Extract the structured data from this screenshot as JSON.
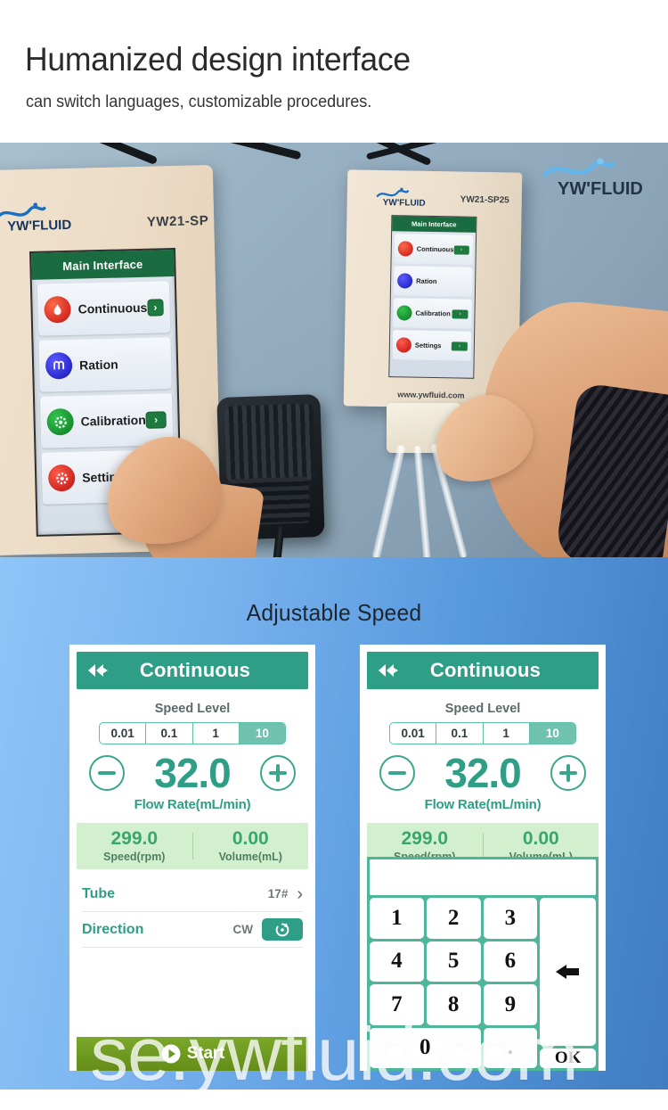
{
  "header": {
    "title": "Humanized design interface",
    "subtitle": "can switch languages, customizable procedures."
  },
  "photo": {
    "brand_logo": "YW'FLUID",
    "left_device": {
      "brand": "YW'FLUID",
      "model": "YW21-SP",
      "screen_title": "Main Interface",
      "menu": [
        {
          "label": "Continuous",
          "icon": "flame-drop-icon",
          "icon_color": "#d41f1f",
          "arrow": "›"
        },
        {
          "label": "Ration",
          "icon": "ration-icon",
          "icon_color": "#2020c8",
          "arrow": "›"
        },
        {
          "label": "Calibration",
          "icon": "gear-icon",
          "icon_color": "#108a28",
          "arrow": "›"
        },
        {
          "label": "Settings",
          "icon": "settings-gear-icon",
          "icon_color": "#d42020",
          "arrow": "›"
        }
      ]
    },
    "right_device": {
      "brand": "YW'FLUID",
      "model": "YW21-SP25",
      "url": "www.ywfluid.com",
      "screen_title": "Main Interface",
      "menu": [
        {
          "label": "Continuous",
          "icon_color": "#d41f1f",
          "arrow": "›"
        },
        {
          "label": "Ration",
          "icon_color": "#2020c8",
          "arrow": "›"
        },
        {
          "label": "Calibration",
          "icon_color": "#108a28",
          "arrow": "›"
        },
        {
          "label": "Settings",
          "icon_color": "#d42020",
          "arrow": "›"
        }
      ]
    }
  },
  "blue_section": {
    "title": "Adjustable Speed",
    "panel_left": {
      "header_title": "Continuous",
      "back_icon": "double-back-arrow-icon",
      "speed_level_label": "Speed Level",
      "speed_levels": [
        "0.01",
        "0.1",
        "1",
        "10"
      ],
      "speed_level_selected": "10",
      "minus_label": "−",
      "plus_label": "+",
      "flow_value": "32.0",
      "flow_unit": "Flow Rate(mL/min)",
      "stats": [
        {
          "value": "299.0",
          "label": "Speed(rpm)"
        },
        {
          "value": "0.00",
          "label": "Volume(mL)"
        }
      ],
      "rows": [
        {
          "label": "Tube",
          "value": "17#",
          "chevron": "›"
        },
        {
          "label": "Direction",
          "value": "CW",
          "button_icon": "rotate-cw-icon"
        }
      ],
      "start_label": "Start",
      "start_icon": "play-icon"
    },
    "panel_right": {
      "header_title": "Continuous",
      "back_icon": "double-back-arrow-icon",
      "speed_level_label": "Speed Level",
      "speed_levels": [
        "0.01",
        "0.1",
        "1",
        "10"
      ],
      "speed_level_selected": "10",
      "minus_label": "−",
      "plus_label": "+",
      "flow_value": "32.0",
      "flow_unit": "Flow Rate(mL/min)",
      "stats": [
        {
          "value": "299.0",
          "label": "Speed(rpm)"
        },
        {
          "value": "0.00",
          "label": "Volume(mL)"
        }
      ],
      "keypad": {
        "display_value": "",
        "keys": [
          "1",
          "2",
          "3",
          "4",
          "5",
          "6",
          "7",
          "8",
          "9",
          "0",
          "."
        ],
        "backspace_icon": "backspace-arrow-icon",
        "ok_label": "OK"
      }
    }
  },
  "watermark": "se.ywfluid.com",
  "colors": {
    "teal": "#2f9e86",
    "teal_light": "#6fc3ae",
    "green_band": "#d3f0ce",
    "green_text": "#3aa66b",
    "start_green": "#6a9a20",
    "blue_left": "#8fc5f7",
    "blue_right": "#3f7cc2",
    "device_green": "#1b6b40"
  }
}
